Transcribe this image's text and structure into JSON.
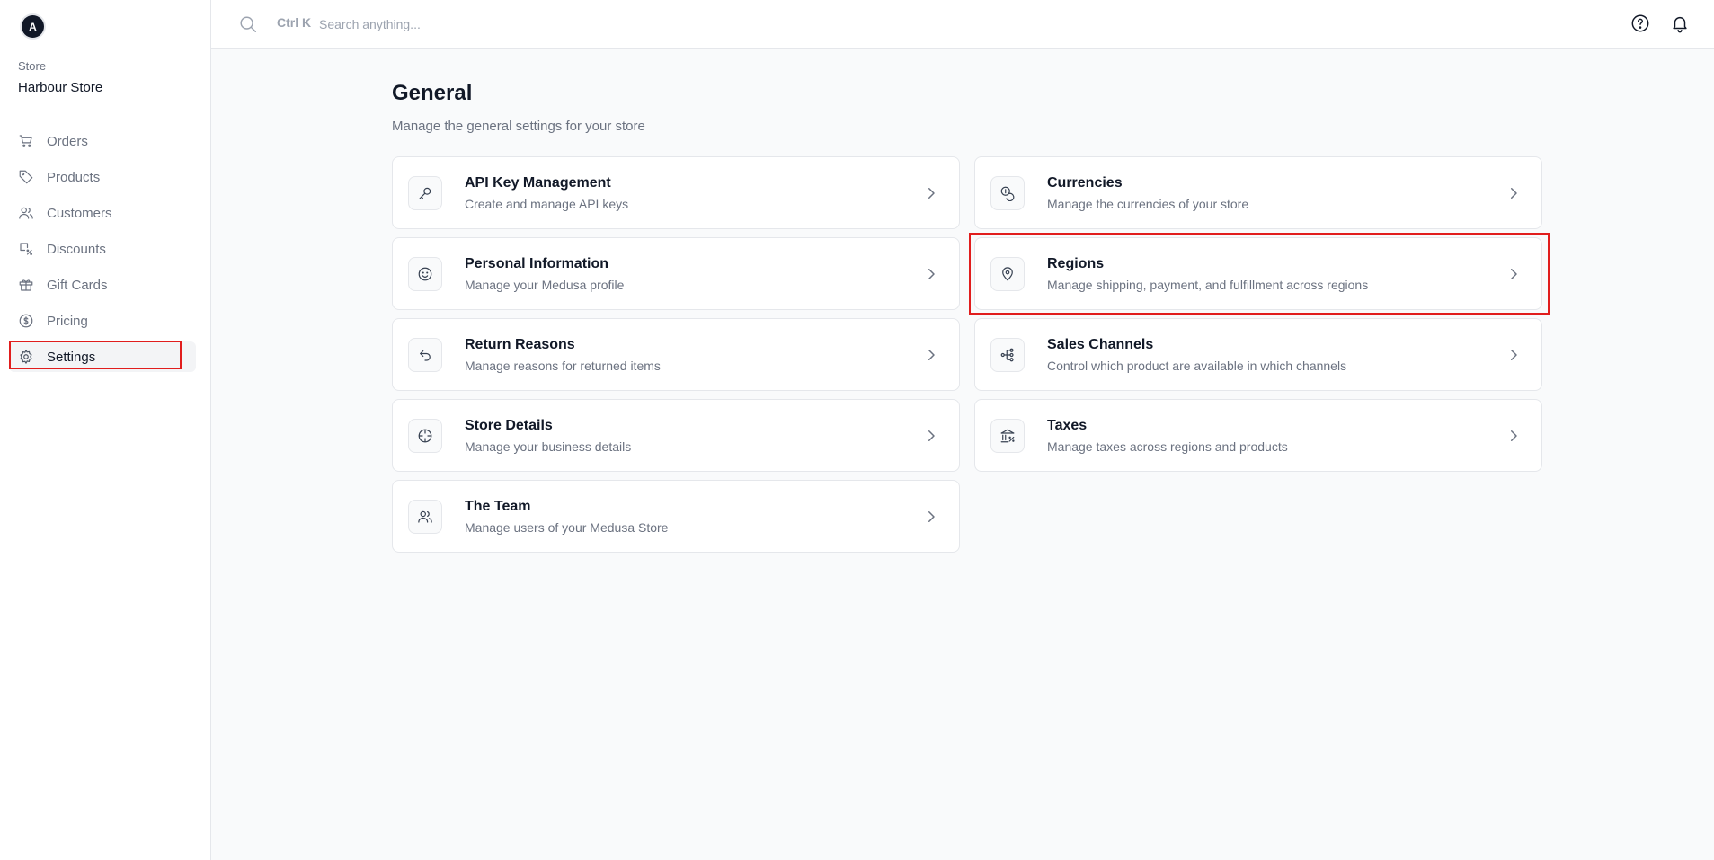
{
  "sidebar": {
    "avatar_letter": "A",
    "store_label": "Store",
    "store_name": "Harbour Store",
    "items": [
      {
        "label": "Orders",
        "icon": "cart-icon"
      },
      {
        "label": "Products",
        "icon": "tag-icon"
      },
      {
        "label": "Customers",
        "icon": "users-icon"
      },
      {
        "label": "Discounts",
        "icon": "discount-icon"
      },
      {
        "label": "Gift Cards",
        "icon": "gift-icon"
      },
      {
        "label": "Pricing",
        "icon": "dollar-icon"
      },
      {
        "label": "Settings",
        "icon": "gear-icon",
        "active": true
      }
    ]
  },
  "topbar": {
    "shortcut": "Ctrl K",
    "search_placeholder": "Search anything..."
  },
  "main": {
    "title": "General",
    "subtitle": "Manage the general settings for your store",
    "cards": [
      {
        "title": "API Key Management",
        "desc": "Create and manage API keys",
        "icon": "key-icon"
      },
      {
        "title": "Currencies",
        "desc": "Manage the currencies of your store",
        "icon": "coins-icon"
      },
      {
        "title": "Personal Information",
        "desc": "Manage your Medusa profile",
        "icon": "smiley-icon"
      },
      {
        "title": "Regions",
        "desc": "Manage shipping, payment, and fulfillment across regions",
        "icon": "map-pin-icon",
        "highlighted": true
      },
      {
        "title": "Return Reasons",
        "desc": "Manage reasons for returned items",
        "icon": "return-arrow-icon"
      },
      {
        "title": "Sales Channels",
        "desc": "Control which product are available in which channels",
        "icon": "channels-icon"
      },
      {
        "title": "Store Details",
        "desc": "Manage your business details",
        "icon": "crosshair-icon"
      },
      {
        "title": "Taxes",
        "desc": "Manage taxes across regions and products",
        "icon": "bank-tax-icon"
      },
      {
        "title": "The Team",
        "desc": "Manage users of your Medusa Store",
        "icon": "team-icon"
      }
    ]
  },
  "colors": {
    "highlight_border": "#e11d1d",
    "text_primary": "#111827",
    "text_muted": "#6b7280",
    "background": "#f9fafb"
  }
}
